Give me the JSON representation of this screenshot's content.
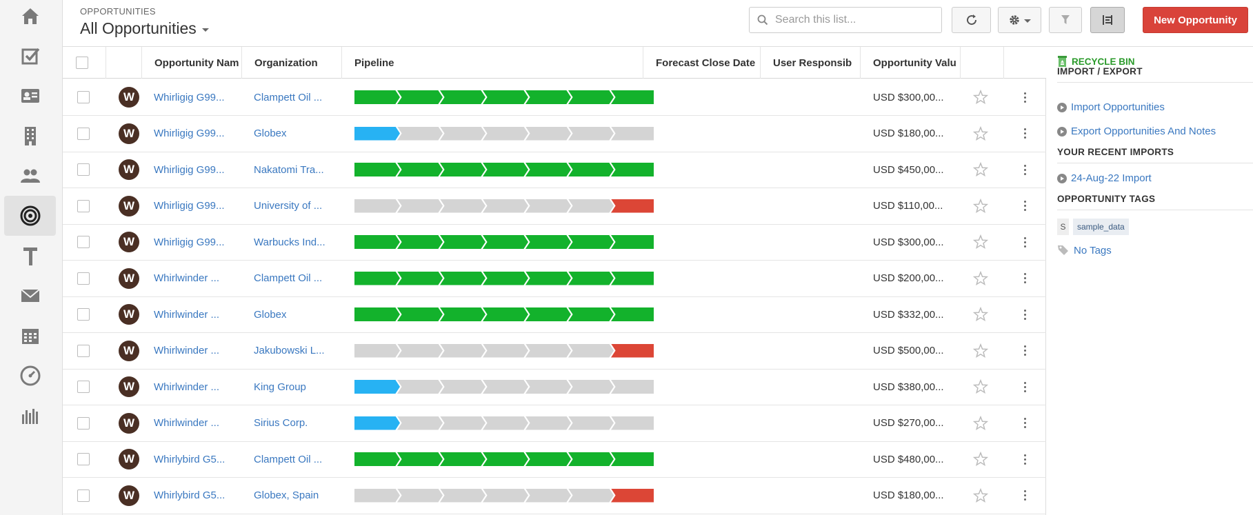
{
  "header": {
    "breadcrumb": "OPPORTUNITIES",
    "title": "All Opportunities",
    "search_placeholder": "Search this list...",
    "new_button": "New Opportunity"
  },
  "nav": {
    "items": [
      "home",
      "tasks",
      "contacts",
      "organizations",
      "leads",
      "opportunities",
      "projects",
      "emails",
      "calendar",
      "dashboard",
      "reports"
    ],
    "active": "opportunities"
  },
  "table": {
    "columns": [
      "Opportunity Nam",
      "Organization",
      "Pipeline",
      "Forecast Close Date",
      "User Responsib",
      "Opportunity Valu"
    ],
    "rows": [
      {
        "avatar": "W",
        "name": "Whirligig G99...",
        "org": "Clampett Oil ...",
        "pipeline": [
          "green",
          "green",
          "green",
          "green",
          "green",
          "green",
          "green"
        ],
        "forecast": "",
        "user": "",
        "value": "USD $300,00..."
      },
      {
        "avatar": "W",
        "name": "Whirligig G99...",
        "org": "Globex",
        "pipeline": [
          "blue",
          "gray",
          "gray",
          "gray",
          "gray",
          "gray",
          "gray"
        ],
        "forecast": "",
        "user": "",
        "value": "USD $180,00..."
      },
      {
        "avatar": "W",
        "name": "Whirligig G99...",
        "org": "Nakatomi Tra...",
        "pipeline": [
          "green",
          "green",
          "green",
          "green",
          "green",
          "green",
          "green"
        ],
        "forecast": "",
        "user": "",
        "value": "USD $450,00..."
      },
      {
        "avatar": "W",
        "name": "Whirligig G99...",
        "org": "University of ...",
        "pipeline": [
          "gray",
          "gray",
          "gray",
          "gray",
          "gray",
          "gray",
          "red"
        ],
        "forecast": "",
        "user": "",
        "value": "USD $110,00..."
      },
      {
        "avatar": "W",
        "name": "Whirligig G99...",
        "org": "Warbucks Ind...",
        "pipeline": [
          "green",
          "green",
          "green",
          "green",
          "green",
          "green",
          "green"
        ],
        "forecast": "",
        "user": "",
        "value": "USD $300,00..."
      },
      {
        "avatar": "W",
        "name": "Whirlwinder ...",
        "org": "Clampett Oil ...",
        "pipeline": [
          "green",
          "green",
          "green",
          "green",
          "green",
          "green",
          "green"
        ],
        "forecast": "",
        "user": "",
        "value": "USD $200,00..."
      },
      {
        "avatar": "W",
        "name": "Whirlwinder ...",
        "org": "Globex",
        "pipeline": [
          "green",
          "green",
          "green",
          "green",
          "green",
          "green",
          "green"
        ],
        "forecast": "",
        "user": "",
        "value": "USD $332,00..."
      },
      {
        "avatar": "W",
        "name": "Whirlwinder ...",
        "org": "Jakubowski L...",
        "pipeline": [
          "gray",
          "gray",
          "gray",
          "gray",
          "gray",
          "gray",
          "red"
        ],
        "forecast": "",
        "user": "",
        "value": "USD $500,00..."
      },
      {
        "avatar": "W",
        "name": "Whirlwinder ...",
        "org": "King Group",
        "pipeline": [
          "blue",
          "gray",
          "gray",
          "gray",
          "gray",
          "gray",
          "gray"
        ],
        "forecast": "",
        "user": "",
        "value": "USD $380,00..."
      },
      {
        "avatar": "W",
        "name": "Whirlwinder ...",
        "org": "Sirius Corp.",
        "pipeline": [
          "blue",
          "gray",
          "gray",
          "gray",
          "gray",
          "gray",
          "gray"
        ],
        "forecast": "",
        "user": "",
        "value": "USD $270,00..."
      },
      {
        "avatar": "W",
        "name": "Whirlybird G5...",
        "org": "Clampett Oil ...",
        "pipeline": [
          "green",
          "green",
          "green",
          "green",
          "green",
          "green",
          "green"
        ],
        "forecast": "",
        "user": "",
        "value": "USD $480,00..."
      },
      {
        "avatar": "W",
        "name": "Whirlybird G5...",
        "org": "Globex, Spain",
        "pipeline": [
          "gray",
          "gray",
          "gray",
          "gray",
          "gray",
          "gray",
          "red"
        ],
        "forecast": "",
        "user": "",
        "value": "USD $180,00..."
      }
    ]
  },
  "sidebar": {
    "recycle_bin": "RECYCLE BIN",
    "import_export_heading": "IMPORT / EXPORT",
    "import_link": "Import Opportunities",
    "export_link": "Export Opportunities And Notes",
    "recent_imports_heading": "YOUR RECENT IMPORTS",
    "recent_import": "24-Aug-22 Import",
    "tags_heading": "OPPORTUNITY TAGS",
    "tag_letter": "S",
    "tag_name": "sample_data",
    "no_tags": "No Tags"
  },
  "colors": {
    "green": "#13b22c",
    "blue": "#27b2f3",
    "gray": "#d4d4d4",
    "red": "#dc4636",
    "link": "#3a78c0",
    "accent_button": "#d9433a"
  }
}
